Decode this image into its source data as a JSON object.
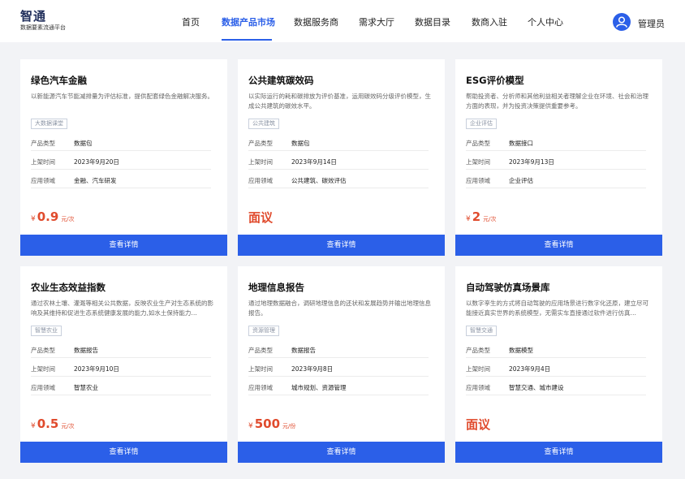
{
  "brand": {
    "title": "智通",
    "subtitle": "数据要素流通平台"
  },
  "nav": [
    {
      "label": "首页",
      "active": false
    },
    {
      "label": "数据产品市场",
      "active": true
    },
    {
      "label": "数据服务商",
      "active": false
    },
    {
      "label": "需求大厅",
      "active": false
    },
    {
      "label": "数据目录",
      "active": false
    },
    {
      "label": "数商入驻",
      "active": false
    },
    {
      "label": "个人中心",
      "active": false
    }
  ],
  "user": {
    "name": "管理员"
  },
  "labels": {
    "type": "产品类型",
    "date": "上架时间",
    "field": "应用领域",
    "button": "查看详情",
    "currency": "¥"
  },
  "colors": {
    "accent": "#2b5fe8",
    "price": "#e04b2d"
  },
  "cards": [
    {
      "title": "绿色汽车金融",
      "desc": "以新能源汽车节能减排量为评估标准，提供配套绿色金融解决服务。",
      "tag": "大数据课堂",
      "type": "数据包",
      "date": "2023年9月20日",
      "field": "金融、汽车研发",
      "price": "0.9",
      "unit": "元/次",
      "negotiable": ""
    },
    {
      "title": "公共建筑碳效码",
      "desc": "以实际运行的耗和碳排放为评价基准，运用碳效码分级评价模型，生成公共建筑的碳效水平。",
      "tag": "公共建筑",
      "type": "数据包",
      "date": "2023年9月14日",
      "field": "公共建筑、碳效评估",
      "price": "",
      "unit": "",
      "negotiable": "面议"
    },
    {
      "title": "ESG评价模型",
      "desc": "帮助投资者、分析师和其他利益相关者理解企业在环境、社会和治理方面的表现，并为投资决策提供重要参考。",
      "tag": "企业评估",
      "type": "数据接口",
      "date": "2023年9月13日",
      "field": "企业评估",
      "price": "2",
      "unit": "元/次",
      "negotiable": ""
    },
    {
      "title": "农业生态效益指数",
      "desc": "通过农林土壤、灌溉等相关公共数据，反映农业生产对生态系统的影响及其维持和促进生态系统健康发展的能力,如水土保持能力…",
      "tag": "智慧农业",
      "type": "数据报告",
      "date": "2023年9月10日",
      "field": "智慧农业",
      "price": "0.5",
      "unit": "元/次",
      "negotiable": ""
    },
    {
      "title": "地理信息报告",
      "desc": "通过地理数据融合，调研地理信息的还状和发展趋势并输出地理信息报告。",
      "tag": "资源管理",
      "type": "数据报告",
      "date": "2023年9月8日",
      "field": "城市规划、资源管理",
      "price": "500",
      "unit": "元/份",
      "negotiable": ""
    },
    {
      "title": "自动驾驶仿真场景库",
      "desc": "以数字孪生的方式将自动驾驶的应用场景进行数字化还原，建立尽可能接近真实世界的系统模型，无需实车直接通过软件进行仿真…",
      "tag": "智慧交通",
      "type": "数据模型",
      "date": "2023年9月4日",
      "field": "智慧交通、城市建设",
      "price": "",
      "unit": "",
      "negotiable": "面议"
    }
  ]
}
